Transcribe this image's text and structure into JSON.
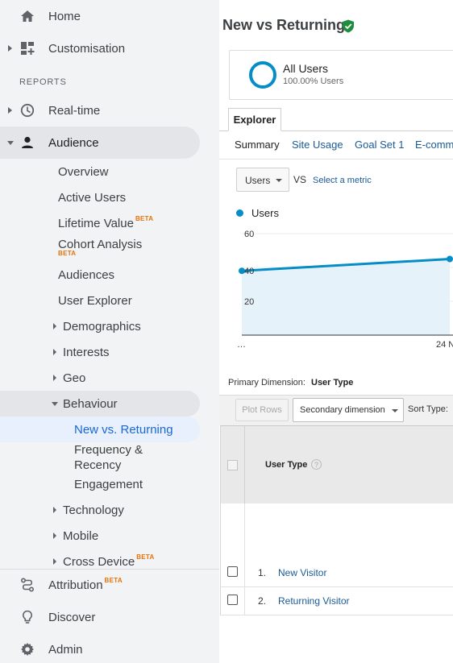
{
  "sidebar": {
    "home": "Home",
    "customisation": "Customisation",
    "reports_header": "REPORTS",
    "realtime": "Real-time",
    "audience": "Audience",
    "audience_items": {
      "overview": "Overview",
      "active_users": "Active Users",
      "lifetime_value": "Lifetime Value",
      "cohort_analysis": "Cohort Analysis",
      "audiences": "Audiences",
      "user_explorer": "User Explorer",
      "demographics": "Demographics",
      "interests": "Interests",
      "geo": "Geo",
      "behaviour": "Behaviour",
      "technology": "Technology",
      "mobile": "Mobile",
      "cross_device": "Cross Device"
    },
    "behaviour_items": {
      "new_vs_returning": "New vs. Returning",
      "frequency_line1": "Frequency &",
      "frequency_line2": "Recency",
      "engagement": "Engagement"
    },
    "attribution": "Attribution",
    "discover": "Discover",
    "admin": "Admin",
    "beta_label": "BETA"
  },
  "main": {
    "title": "New vs Returning",
    "segment": {
      "name": "All Users",
      "percent": "100.00% Users"
    },
    "tab": "Explorer",
    "subtabs": [
      "Summary",
      "Site Usage",
      "Goal Set 1",
      "E-comm"
    ],
    "metric_select": "Users",
    "vs": "VS",
    "select_metric": "Select a metric",
    "legend": "Users",
    "primary_dimension_label": "Primary Dimension:",
    "primary_dimension_value": "User Type",
    "plot_rows": "Plot Rows",
    "secondary_dimension": "Secondary dimension",
    "sort_type": "Sort Type:",
    "table": {
      "header": "User Type",
      "help": "?",
      "rows": [
        {
          "num": "1.",
          "label": "New Visitor"
        },
        {
          "num": "2.",
          "label": "Returning Visitor"
        }
      ]
    }
  },
  "chart_data": {
    "type": "area",
    "x_labels": [
      "…",
      "24 N"
    ],
    "series": [
      {
        "name": "Users",
        "values": [
          38,
          45
        ]
      }
    ],
    "value_labels": [
      "40"
    ],
    "y_ticks": [
      20,
      40,
      60
    ],
    "ylim": [
      0,
      60
    ],
    "color": "#058dc7",
    "fill": "#e6f2f9"
  },
  "colors": {
    "sidebar_bg": "#f1f3f4",
    "active_bg": "#e8f0fe",
    "active_text": "#1967d2",
    "link": "#1a5a96",
    "accent": "#058dc7",
    "beta": "#e8710a",
    "verified": "#1e8e3e"
  }
}
